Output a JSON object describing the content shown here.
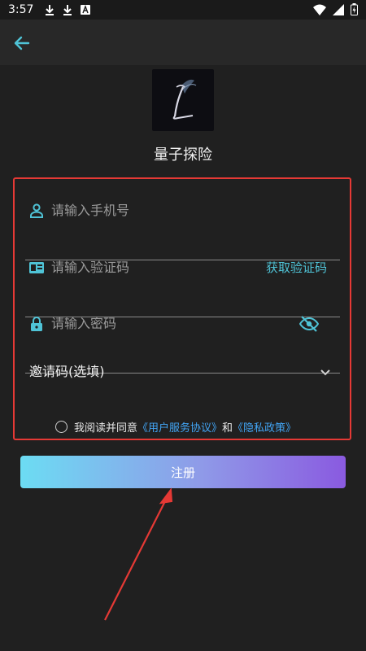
{
  "status_bar": {
    "time": "3:57",
    "left_icons": [
      "download-icon",
      "download-icon",
      "app-store-icon"
    ],
    "right_icons": [
      "wifi-icon",
      "signal-icon",
      "battery-icon"
    ]
  },
  "app_bar": {
    "back_icon": "arrow-left-icon"
  },
  "app": {
    "name": "量子探险",
    "logo_letter": "L"
  },
  "form": {
    "phone": {
      "placeholder": "请输入手机号",
      "icon": "person-icon"
    },
    "code": {
      "placeholder": "请输入验证码",
      "icon": "card-icon",
      "action": "获取验证码"
    },
    "password": {
      "placeholder": "请输入密码",
      "icon": "lock-icon",
      "toggle_icon": "eye-off-icon"
    },
    "invite": {
      "label": "邀请码(选填)",
      "icon": "chevron-down-icon"
    },
    "agreement": {
      "prefix": "我阅读并同意",
      "terms": "《用户服务协议》",
      "and": "和",
      "privacy": "《隐私政策》",
      "checked": false
    }
  },
  "register_button": "注册",
  "colors": {
    "accent": "#4fc3d6",
    "link": "#42a5f5",
    "highlight_box": "#e53935",
    "button_gradient": [
      "#6cdcf3",
      "#8a5ae0"
    ]
  }
}
